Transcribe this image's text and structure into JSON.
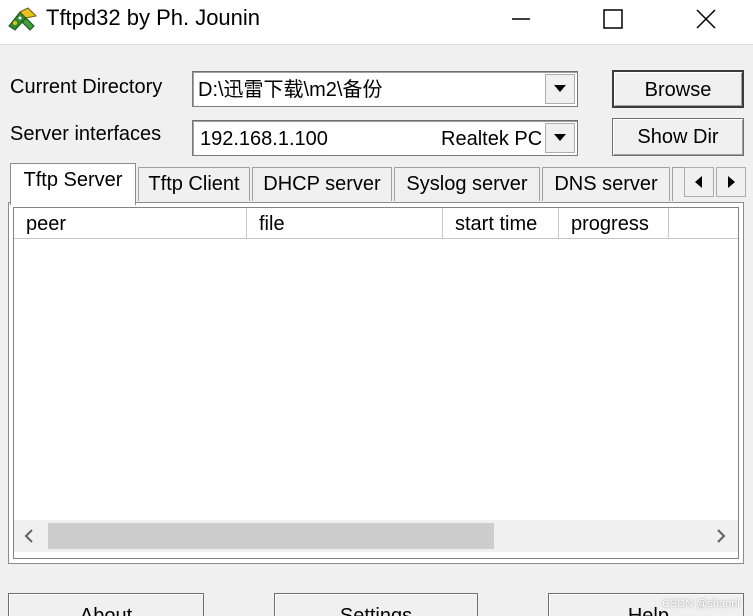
{
  "window": {
    "title": "Tftpd32 by Ph. Jounin",
    "icon": "tftpd32-app-icon"
  },
  "settings": {
    "current_directory_label": "Current Directory",
    "current_directory_value": "D:\\迅雷下载\\m2\\备份",
    "server_interfaces_label": "Server interfaces",
    "server_interface_ip": "192.168.1.100",
    "server_interface_adapter": "Realtek PC",
    "browse_label": "Browse",
    "show_dir_label": "Show Dir"
  },
  "tabs": [
    {
      "label": "Tftp Server",
      "active": true
    },
    {
      "label": "Tftp Client",
      "active": false
    },
    {
      "label": "DHCP server",
      "active": false
    },
    {
      "label": "Syslog server",
      "active": false
    },
    {
      "label": "DNS server",
      "active": false
    }
  ],
  "table": {
    "columns": [
      "peer",
      "file",
      "start time",
      "progress"
    ],
    "rows": []
  },
  "buttons": {
    "about": "About",
    "settings": "Settings",
    "help": "Help"
  },
  "watermark": "CSDN @shaonl"
}
